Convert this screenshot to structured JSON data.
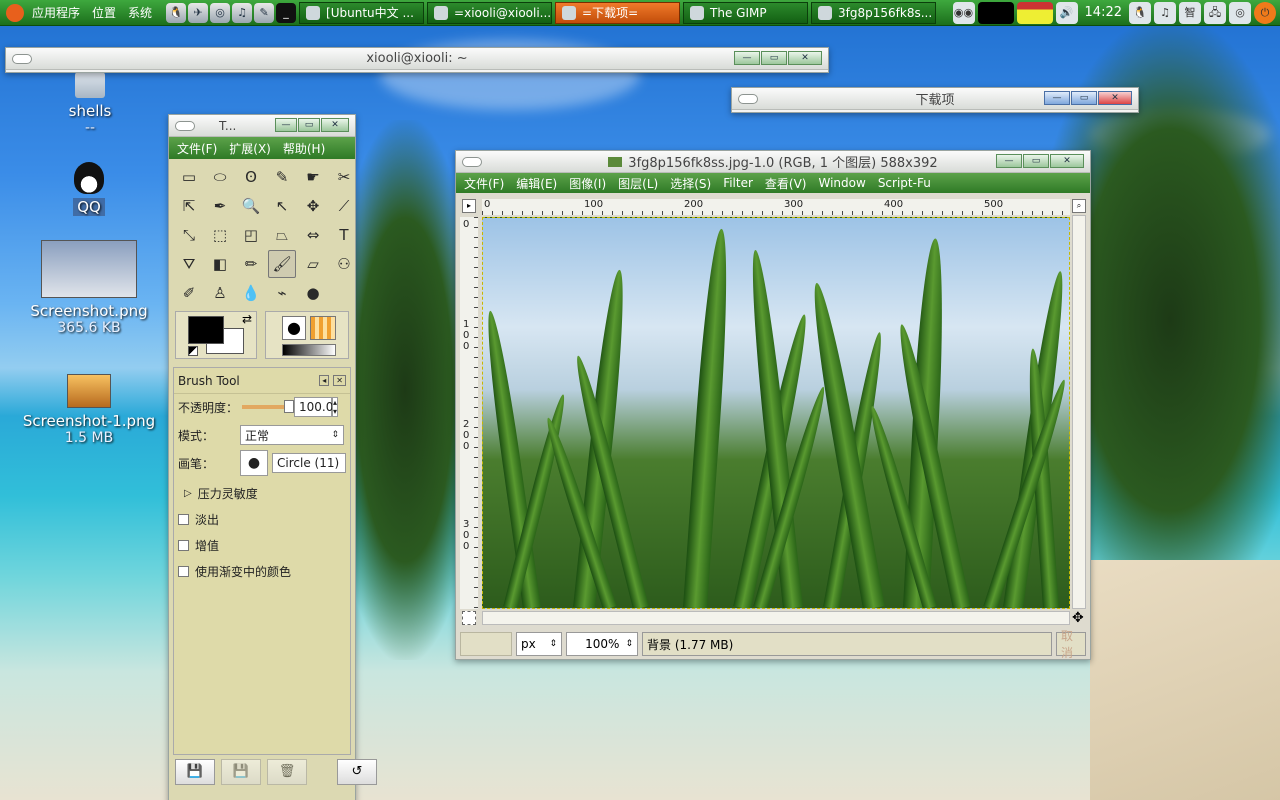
{
  "panel": {
    "menus": [
      "应用程序",
      "位置",
      "系统"
    ],
    "tasks": [
      {
        "label": "[Ubuntu中文 ...",
        "active": false
      },
      {
        "label": "=xiooli@xiooli...",
        "active": false
      },
      {
        "label": "=下载项=",
        "active": true
      },
      {
        "label": "The GIMP",
        "active": false
      },
      {
        "label": "3fg8p156fk8s...",
        "active": false
      }
    ],
    "clock": "14:22"
  },
  "desktop": {
    "icons": [
      {
        "label": "shells",
        "sub": "--"
      },
      {
        "label": "QQ",
        "sub": ""
      },
      {
        "label": "Screenshot.png",
        "sub": "365.6 KB"
      },
      {
        "label": "Screenshot-1.png",
        "sub": "1.5 MB"
      }
    ]
  },
  "terminal": {
    "title": "xiooli@xiooli: ~"
  },
  "downloads": {
    "title": "下载项"
  },
  "toolbox": {
    "title": "T...",
    "menus": [
      "文件(F)",
      "扩展(X)",
      "帮助(H)"
    ],
    "tools": [
      "▭",
      "⬭",
      "ʘ",
      "✎",
      "☛",
      "✂",
      "⇱",
      "✒",
      "🔍",
      "↖",
      "✥",
      "⟋",
      "⤡",
      "⬚",
      "◰",
      "⏢",
      "⇔",
      "T",
      "⛛",
      "◧",
      "✏",
      "🖌",
      "▱",
      "⚇",
      "✐",
      "♙",
      "💧",
      "⌁",
      "●"
    ],
    "selected_tool": 21,
    "options": {
      "header": "Brush Tool",
      "opacity_label": "不透明度：",
      "opacity_value": "100.0",
      "mode_label": "模式：",
      "mode_value": "正常",
      "brush_label": "画笔：",
      "brush_value": "Circle (11)",
      "pressure_label": "压力灵敏度",
      "checks": [
        "淡出",
        "增值",
        "使用渐变中的颜色"
      ]
    }
  },
  "image_window": {
    "title": "3fg8p156fk8ss.jpg-1.0 (RGB, 1 个图层) 588x392",
    "menus": [
      "文件(F)",
      "编辑(E)",
      "图像(I)",
      "图层(L)",
      "选择(S)",
      "Filter",
      "查看(V)",
      "Window",
      "Script-Fu"
    ],
    "ruler_h": [
      "0",
      "100",
      "200",
      "300",
      "400",
      "500"
    ],
    "ruler_v": [
      "0",
      "1 0 0",
      "2 0 0",
      "3 0 0"
    ],
    "unit": "px",
    "zoom": "100%",
    "status": "背景 (1.77 MB)",
    "cancel": "取消"
  }
}
